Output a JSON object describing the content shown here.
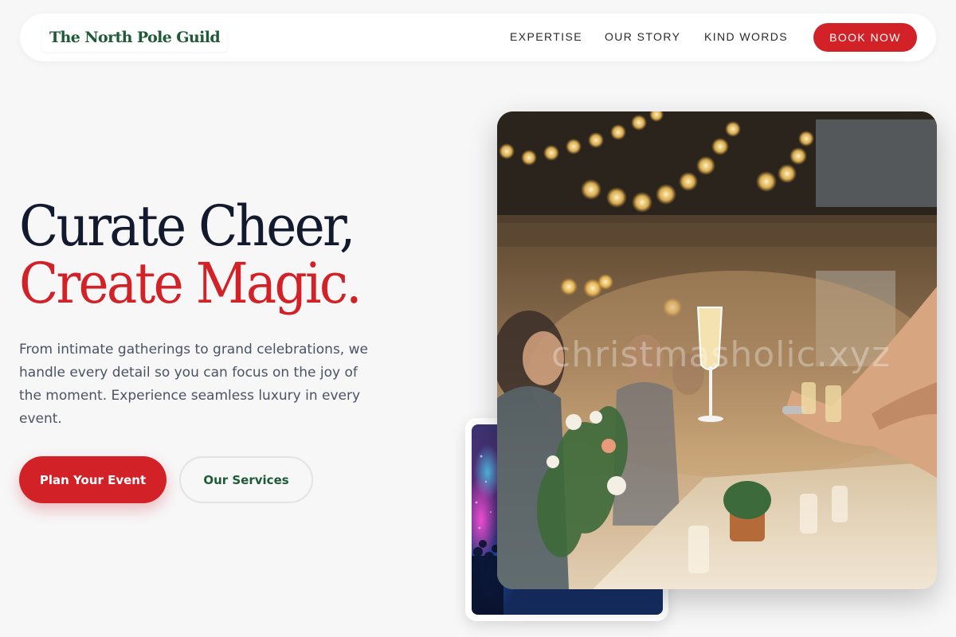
{
  "nav": {
    "brand": "The North Pole Guild",
    "links": [
      "EXPERTISE",
      "OUR STORY",
      "KIND WORDS"
    ],
    "cta": "BOOK NOW"
  },
  "hero": {
    "headline_line1": "Curate Cheer,",
    "headline_line2": "Create Magic.",
    "description": "From intimate gatherings to grand celebrations, we handle every detail so you can focus on the joy of the moment. Experience seamless luxury in every event.",
    "primary_button": "Plan Your Event",
    "secondary_button": "Our Services"
  },
  "images": {
    "main_photo": "champagne-toast-party-photo",
    "secondary_photo": "concert-crowd-lights-photo",
    "watermark": "christmasholic.xyz"
  },
  "colors": {
    "accent_red": "#d32128",
    "brand_green": "#1e5a35",
    "heading_dark": "#141a2e",
    "body_gray": "#4a5263",
    "background": "#f7f7f8"
  }
}
